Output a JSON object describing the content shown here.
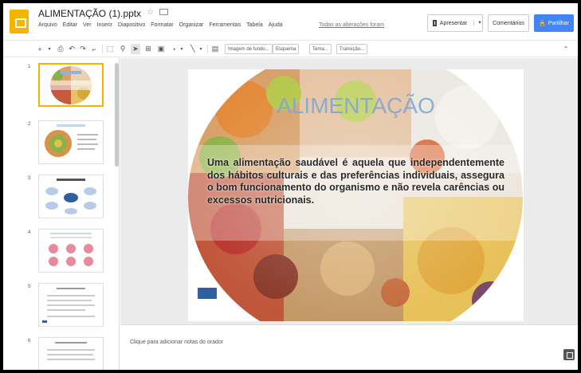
{
  "header": {
    "doc_title": "ALIMENTAÇÃO (1).pptx",
    "menu": [
      "Arquivo",
      "Editar",
      "Ver",
      "Inserir",
      "Diapositivo",
      "Formatar",
      "Organizar",
      "Ferramentas",
      "Tabela",
      "Ajuda"
    ],
    "last_edit": "Todas as alterações foram",
    "present_label": "Apresentar",
    "comments_label": "Comentários",
    "share_label": "Partilhar"
  },
  "toolbar": {
    "background_label": "Imagem de fundo...",
    "layout_label": "Esquema",
    "theme_label": "Tema...",
    "transition_label": "Transição..."
  },
  "filmstrip": {
    "slide_numbers": [
      "1",
      "2",
      "3",
      "4",
      "5",
      "6"
    ]
  },
  "slide": {
    "title": "ALIMENTAÇÃO",
    "body": "Uma alimentação saudável é aquela que independentemente dos hábitos culturais e das preferências individuais, assegura o bom funcionamento do organismo e não revela carências ou excessos nutricionais."
  },
  "notes": {
    "placeholder": "Clique para adicionar notas do orador"
  },
  "colors": {
    "accent_yellow": "#f4b400",
    "share_blue": "#4285f4",
    "title_blue": "#7aa6d8",
    "badge_blue": "#2f5f9e"
  }
}
